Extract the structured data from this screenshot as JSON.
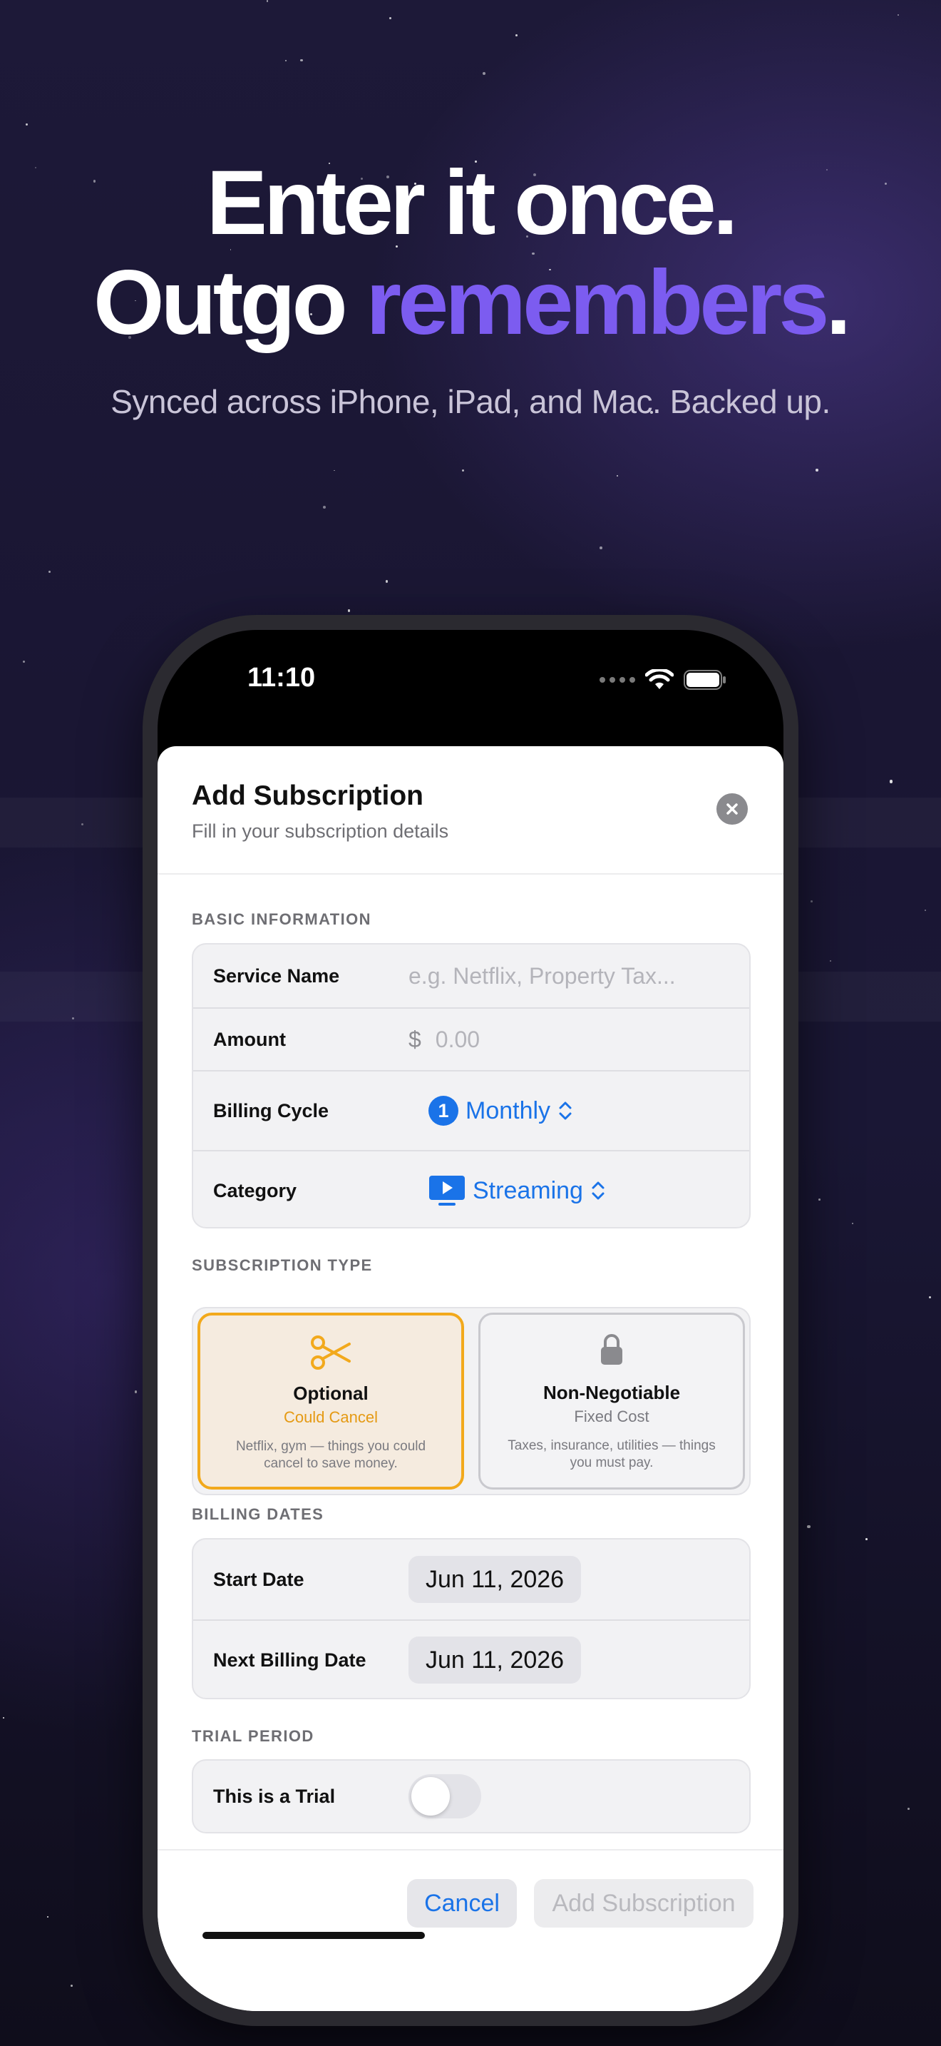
{
  "hero": {
    "line1": "Enter it once.",
    "line2_prefix": "Outgo ",
    "line2_accent": "remembers",
    "line2_suffix": ".",
    "subtitle": "Synced across iPhone, iPad, and Mac. Backed up."
  },
  "status_bar": {
    "time": "11:10"
  },
  "sheet": {
    "title": "Add Subscription",
    "subtitle": "Fill in your subscription details"
  },
  "basic_info": {
    "section_label": "BASIC INFORMATION",
    "service_name_label": "Service Name",
    "service_name_placeholder": "e.g. Netflix, Property Tax...",
    "amount_label": "Amount",
    "amount_currency": "$",
    "amount_placeholder": "0.00",
    "billing_cycle_label": "Billing Cycle",
    "billing_cycle_badge": "1",
    "billing_cycle_value": "Monthly",
    "category_label": "Category",
    "category_value": "Streaming"
  },
  "subscription_type": {
    "section_label": "SUBSCRIPTION TYPE",
    "options": [
      {
        "title": "Optional",
        "subtitle": "Could Cancel",
        "description": "Netflix, gym — things you could cancel to save money.",
        "icon": "scissors-icon",
        "selected": true
      },
      {
        "title": "Non-Negotiable",
        "subtitle": "Fixed Cost",
        "description": "Taxes, insurance, utilities — things you must pay.",
        "icon": "lock-icon",
        "selected": false
      }
    ]
  },
  "billing_dates": {
    "section_label": "BILLING DATES",
    "start_date_label": "Start Date",
    "start_date_value": "Jun 11, 2026",
    "next_billing_label": "Next Billing Date",
    "next_billing_value": "Jun 11, 2026"
  },
  "trial": {
    "section_label": "TRIAL PERIOD",
    "toggle_label": "This is a Trial",
    "enabled": false
  },
  "footer": {
    "cancel_label": "Cancel",
    "add_label": "Add Subscription"
  },
  "colors": {
    "accent_purple": "#7c5cf0",
    "ios_blue": "#1a73e8",
    "optional_orange": "#f2a91c"
  }
}
